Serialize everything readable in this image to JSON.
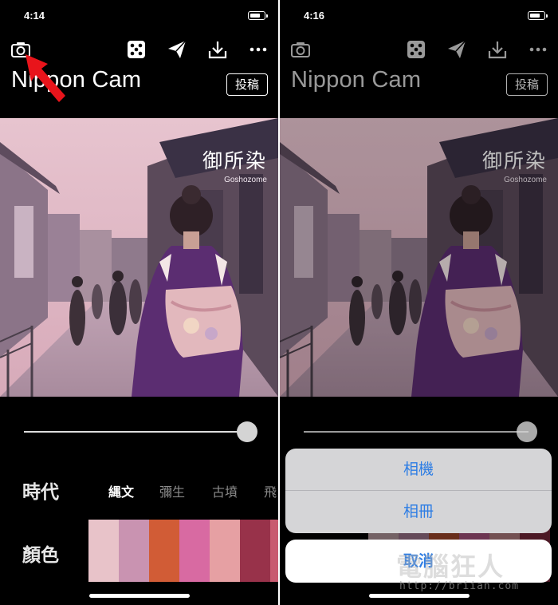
{
  "left": {
    "status_time": "4:14",
    "app_title": "Nippon Cam",
    "post_label": "投稿",
    "photo": {
      "caption_jp": "御所染",
      "caption_en": "Goshozome"
    },
    "slider_value": 0.96,
    "era_label": "時代",
    "eras": [
      "縄文",
      "彌生",
      "古墳",
      "飛"
    ],
    "active_era": "縄文",
    "color_label": "顏色",
    "swatches": [
      "#e8c3c9",
      "#c993b1",
      "#d15c36",
      "#d86aa2",
      "#e6a0a3",
      "#98324a",
      "#c85a6f"
    ],
    "icons": [
      "camera-icon",
      "dice-icon",
      "send-icon",
      "download-icon",
      "more-icon"
    ],
    "annotation": "red-arrow-pointer"
  },
  "right": {
    "status_time": "4:16",
    "app_title": "Nippon Cam",
    "post_label": "投稿",
    "photo": {
      "caption_jp": "御所染",
      "caption_en": "Goshozome"
    },
    "slider_value": 0.96,
    "action_sheet": {
      "options": [
        "相機",
        "相冊"
      ],
      "cancel": "取消"
    },
    "watermark": "電腦狂人",
    "watermark_url": "http://briian.com"
  },
  "colors": {
    "background": "#000000",
    "action_text": "#2d7de4",
    "annotation_arrow": "#e8141b"
  }
}
